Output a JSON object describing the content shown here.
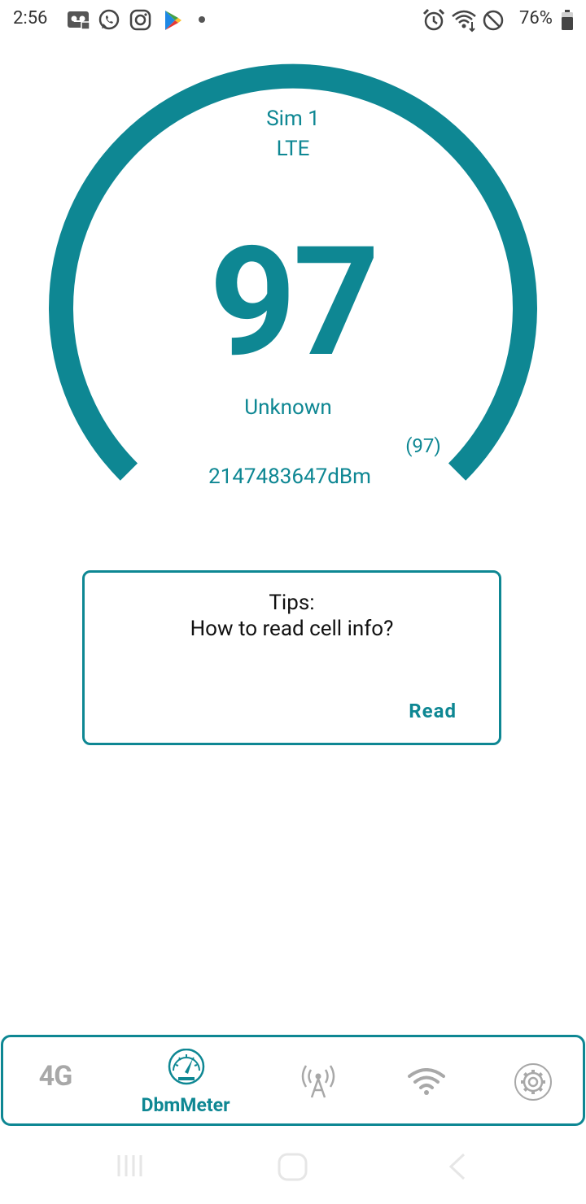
{
  "status_bar": {
    "time": "2:56",
    "battery_percent": "76%",
    "icons": [
      "voicemail-icon",
      "whatsapp-icon",
      "instagram-icon",
      "play-store-icon",
      "dot-icon",
      "alarm-icon",
      "wifi-icon",
      "dnd-icon",
      "battery-icon"
    ]
  },
  "gauge": {
    "sim": "Sim 1",
    "network_type": "LTE",
    "value": "97",
    "quality": "Unknown",
    "level": "(97)",
    "dbm": "2147483647dBm",
    "accent_color": "#0e8793"
  },
  "tips": {
    "title": "Tips:",
    "subtitle": "How to read cell info?",
    "read_label": "Read"
  },
  "bottom_nav": {
    "items": [
      {
        "label": "4G",
        "icon": "4g-icon",
        "active": false
      },
      {
        "label": "DbmMeter",
        "icon": "speedometer-icon",
        "active": true
      },
      {
        "label": "",
        "icon": "cell-tower-icon",
        "active": false
      },
      {
        "label": "",
        "icon": "wifi-icon",
        "active": false
      },
      {
        "label": "",
        "icon": "settings-gear-icon",
        "active": false
      }
    ]
  },
  "system_nav": [
    "recent-apps-icon",
    "home-icon",
    "back-icon"
  ]
}
